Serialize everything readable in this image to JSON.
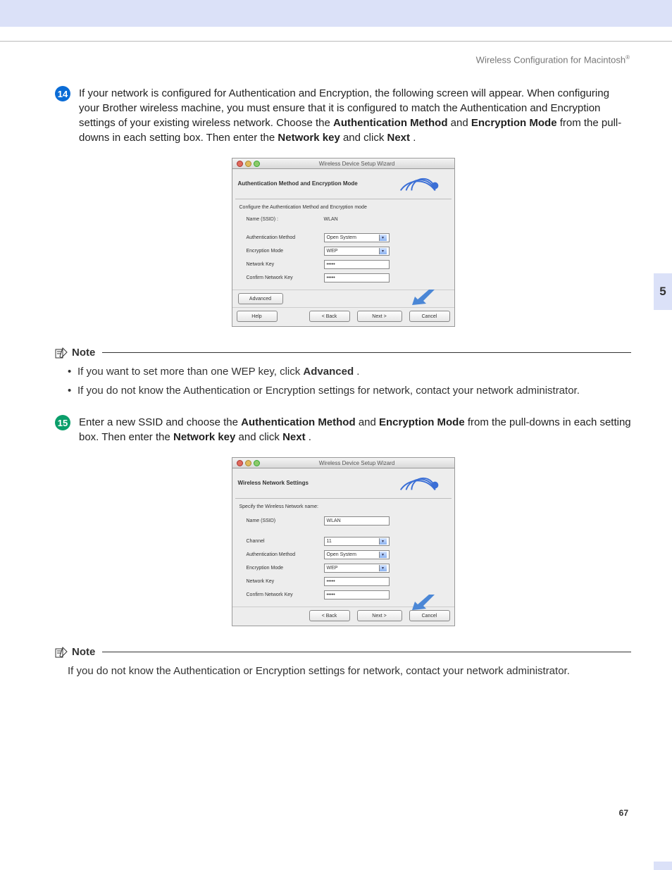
{
  "header": {
    "title": "Wireless Configuration for Macintosh",
    "sup": "®"
  },
  "chapter_tab": "5",
  "page_number": "67",
  "steps": {
    "s14": {
      "num": "14",
      "text_a": "If your network is configured for Authentication and Encryption, the following screen will appear. When configuring your Brother wireless machine, you must ensure that it is configured to match the Authentication and Encryption settings of your existing wireless network. Choose the ",
      "bold_a": "Authentication Method",
      "text_b": " and ",
      "bold_b": "Encryption Mode",
      "text_c": " from the pull-downs in each setting box. Then enter the ",
      "bold_c": "Network key",
      "text_d": " and click ",
      "bold_d": "Next",
      "text_e": "."
    },
    "s15": {
      "num": "15",
      "text_a": "Enter a new SSID and choose the ",
      "bold_a": "Authentication Method",
      "text_b": " and ",
      "bold_b": "Encryption Mode",
      "text_c": " from the pull-downs in each setting box. Then enter the ",
      "bold_c": "Network key",
      "text_d": " and click ",
      "bold_d": "Next",
      "text_e": "."
    }
  },
  "shot1": {
    "win_title": "Wireless Device Setup Wizard",
    "heading": "Authentication Method and Encryption Mode",
    "instr": "Configure the Authentication Method and Encryption mode",
    "ssid_label": "Name (SSID) :",
    "ssid_value": "WLAN",
    "auth_label": "Authentication Method",
    "auth_value": "Open System",
    "enc_label": "Encryption Mode",
    "enc_value": "WEP",
    "key_label": "Network Key",
    "key_value": "•••••",
    "ckey_label": "Confirm Network Key",
    "ckey_value": "•••••",
    "advanced": "Advanced",
    "help": "Help",
    "back": "< Back",
    "next": "Next >",
    "cancel": "Cancel"
  },
  "shot2": {
    "win_title": "Wireless Device Setup Wizard",
    "heading": "Wireless Network Settings",
    "instr": "Specify the Wireless Network name:",
    "ssid_label": "Name (SSID)",
    "ssid_value": "WLAN",
    "chan_label": "Channel",
    "chan_value": "11",
    "auth_label": "Authentication Method",
    "auth_value": "Open System",
    "enc_label": "Encryption Mode",
    "enc_value": "WEP",
    "key_label": "Network Key",
    "key_value": "•••••",
    "ckey_label": "Confirm Network Key",
    "ckey_value": "•••••",
    "back": "< Back",
    "next": "Next >",
    "cancel": "Cancel"
  },
  "notes": {
    "label": "Note",
    "n1_b1_a": "If you want to set more than one WEP key, click ",
    "n1_b1_bold": "Advanced",
    "n1_b1_b": ".",
    "n1_b2": "If you do not know the Authentication or Encryption settings for network, contact your network administrator.",
    "n2": "If you do not know the Authentication or Encryption settings for network, contact your network administrator."
  }
}
